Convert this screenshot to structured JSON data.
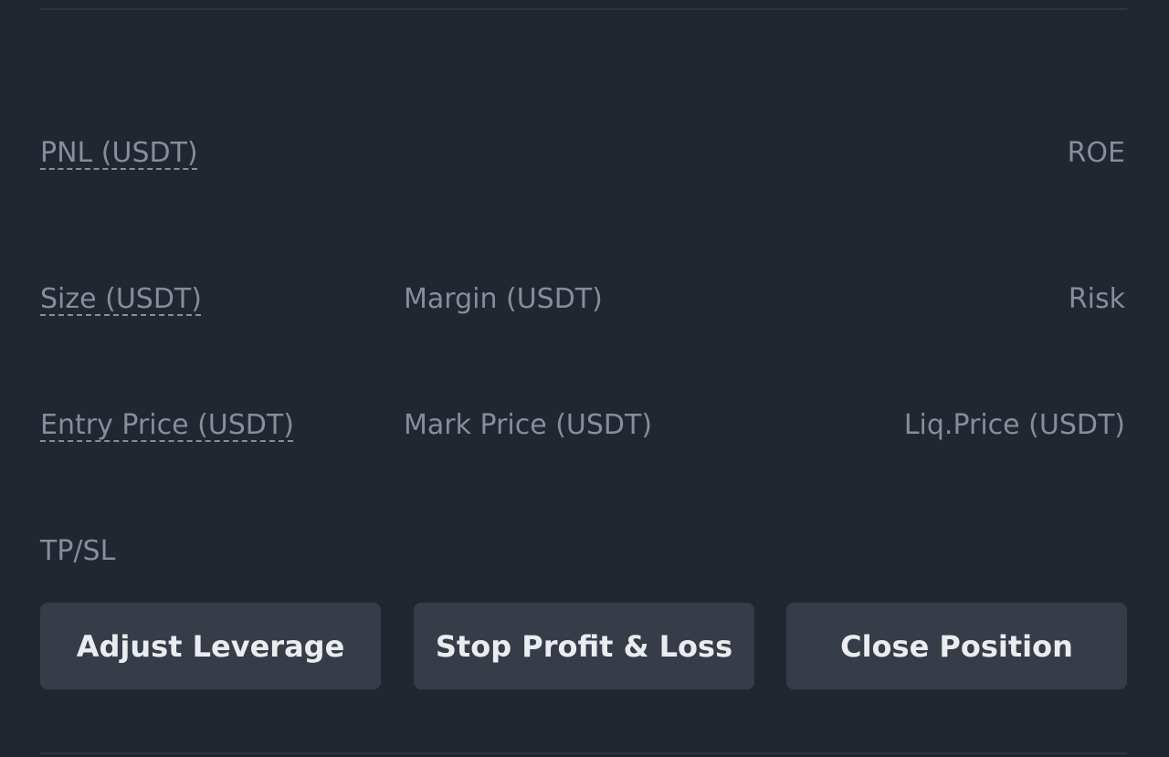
{
  "position": {
    "pnl_label": "PNL (USDT)",
    "roe_label": "ROE",
    "size_label": "Size (USDT)",
    "margin_label": "Margin (USDT)",
    "risk_label": "Risk",
    "entry_price_label": "Entry Price (USDT)",
    "mark_price_label": "Mark Price (USDT)",
    "liq_price_label": "Liq.Price (USDT)",
    "tpsl_label": "TP/SL"
  },
  "actions": {
    "adjust_leverage": "Adjust Leverage",
    "stop_profit_loss": "Stop Profit & Loss",
    "close_position": "Close Position"
  },
  "colors": {
    "background": "#222630",
    "label": "#848e9c",
    "button_bg": "#363c48",
    "button_text": "#eaecef"
  }
}
